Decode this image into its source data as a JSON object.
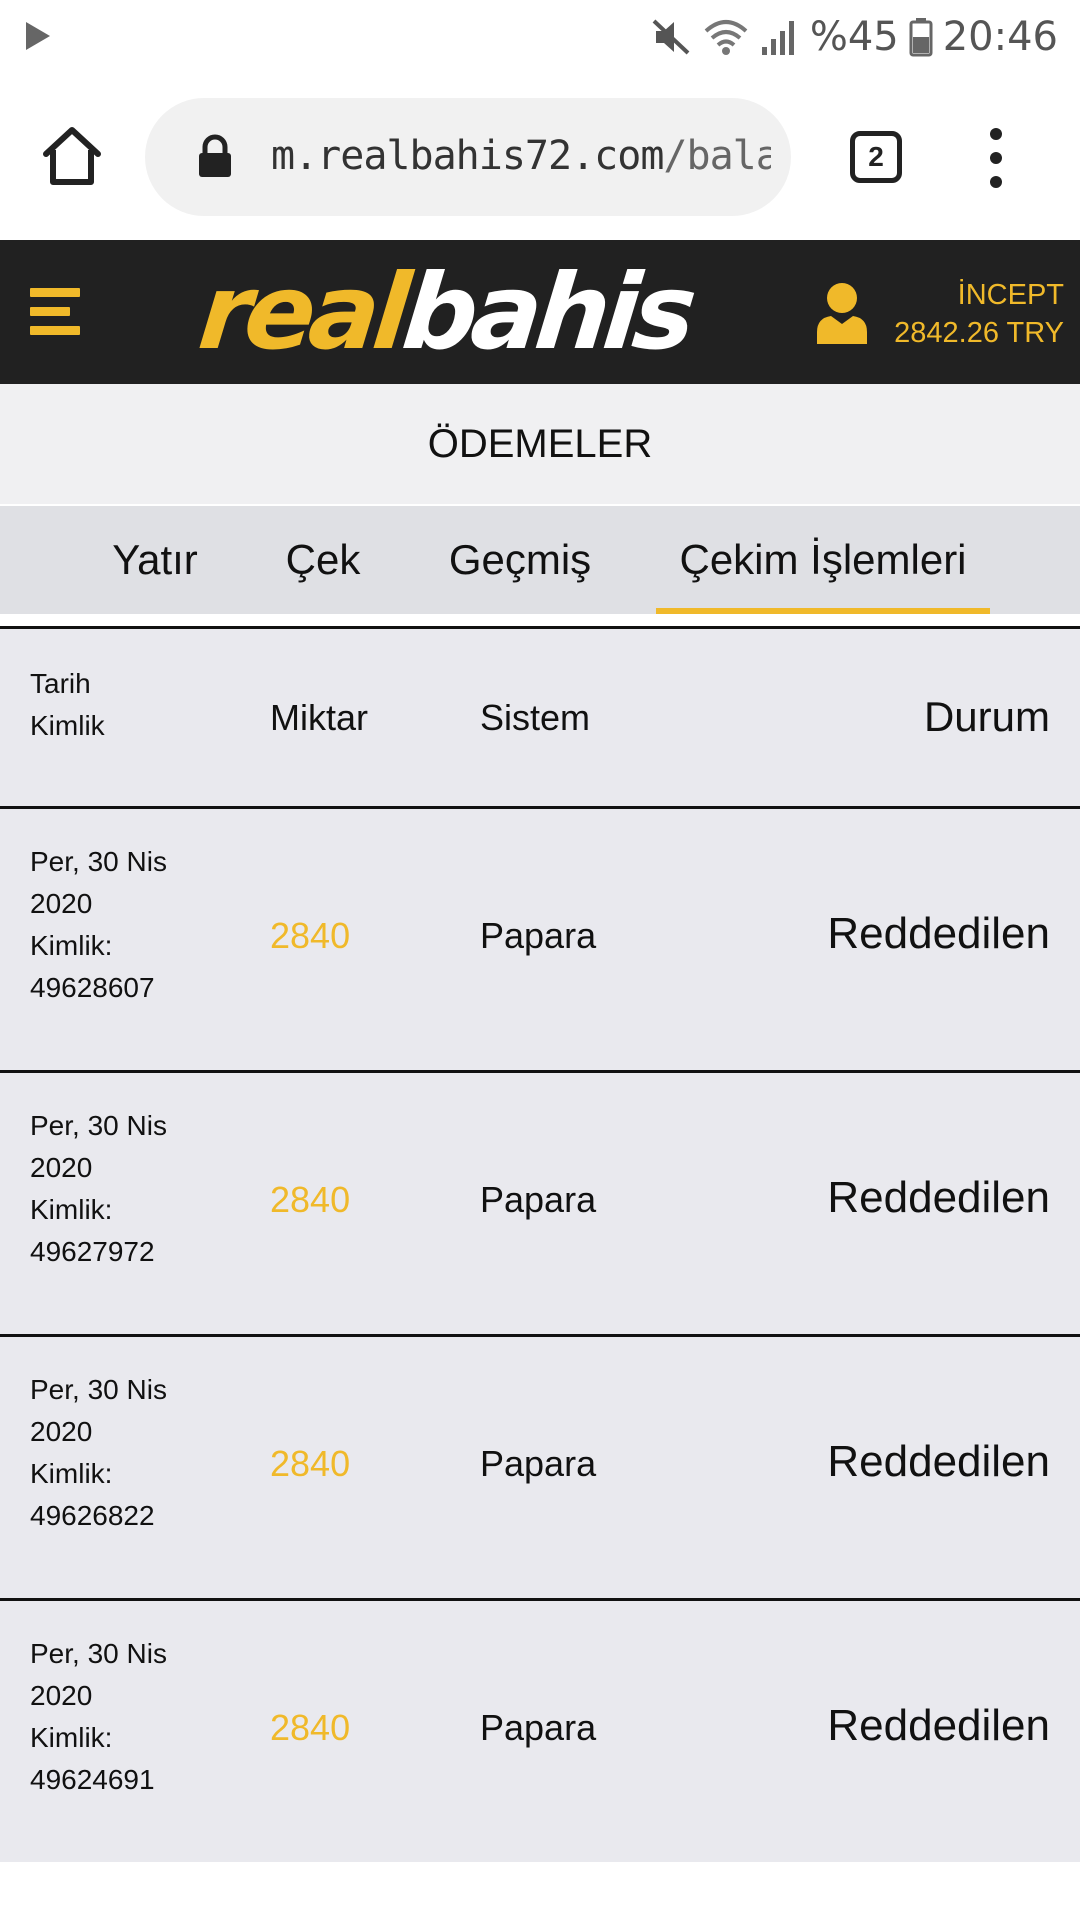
{
  "status_bar": {
    "battery": "%45",
    "time": "20:46"
  },
  "browser": {
    "url_host": "m.realbahis72.com",
    "url_path": "/balance",
    "tab_count": "2"
  },
  "header": {
    "logo_part1": "real",
    "logo_part2": "bahis",
    "username": "İNCEPT",
    "balance": "2842.26 TRY"
  },
  "page": {
    "title": "ÖDEMELER",
    "tabs": [
      {
        "label": "Yatır"
      },
      {
        "label": "Çek"
      },
      {
        "label": "Geçmiş"
      },
      {
        "label": "Çekim İşlemleri"
      }
    ],
    "active_tab": "Çekim İşlemleri"
  },
  "table": {
    "headers": {
      "date": "Tarih",
      "id": "Kimlik",
      "amount": "Miktar",
      "system": "Sistem",
      "status": "Durum"
    },
    "rows": [
      {
        "date_line1": "Per, 30 Nis",
        "date_line2": "2020",
        "id_label": "Kimlik:",
        "id": "49628607",
        "amount": "2840",
        "system": "Papara",
        "status": "Reddedilen"
      },
      {
        "date_line1": "Per, 30 Nis",
        "date_line2": "2020",
        "id_label": "Kimlik:",
        "id": "49627972",
        "amount": "2840",
        "system": "Papara",
        "status": "Reddedilen"
      },
      {
        "date_line1": "Per, 30 Nis",
        "date_line2": "2020",
        "id_label": "Kimlik:",
        "id": "49626822",
        "amount": "2840",
        "system": "Papara",
        "status": "Reddedilen"
      },
      {
        "date_line1": "Per, 30 Nis",
        "date_line2": "2020",
        "id_label": "Kimlik:",
        "id": "49624691",
        "amount": "2840",
        "system": "Papara",
        "status": "Reddedilen"
      }
    ]
  },
  "colors": {
    "brand_yellow": "#f0b92a",
    "header_dark": "#212121"
  }
}
